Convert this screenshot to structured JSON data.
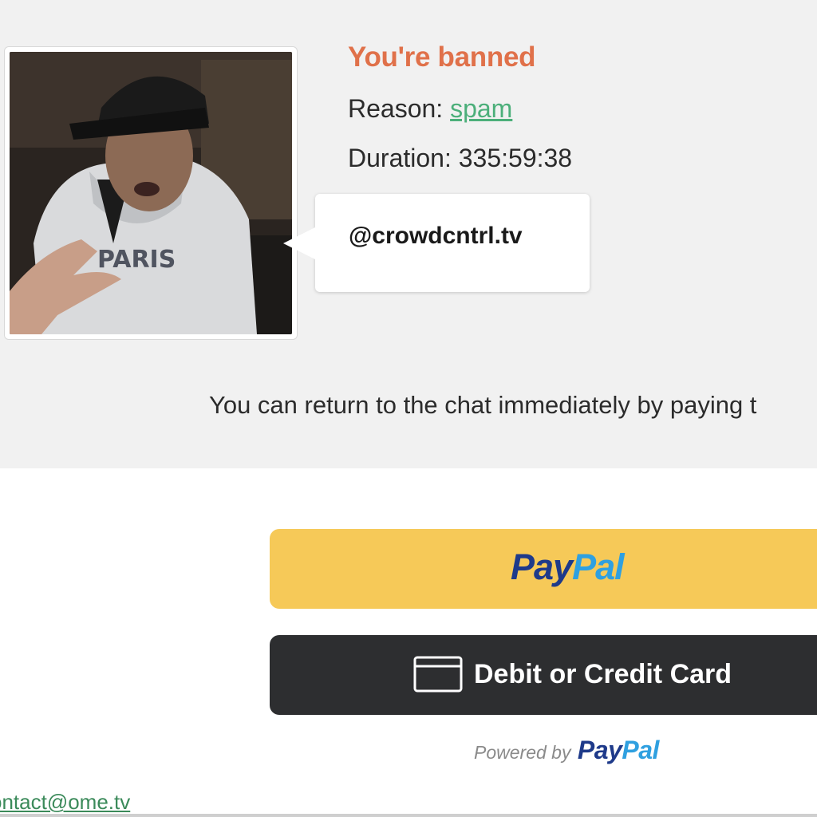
{
  "ban": {
    "title": "You're banned",
    "reason_label": "Reason:",
    "reason_value": "spam",
    "duration_label": "Duration:",
    "duration_value": "335:59:38",
    "return_text": "You can return to the chat immediately by paying t",
    "title_color": "#e0714a",
    "link_color": "#4caf7a"
  },
  "bubble": {
    "handle": "@crowdcntrl.tv"
  },
  "payment": {
    "paypal_button": {
      "logo_part1": "Pay",
      "logo_part2": "Pal",
      "bg_color": "#f6c958"
    },
    "card_button": {
      "label": "Debit or Credit Card",
      "icon": "credit-card-icon",
      "bg_color": "#2d2e30"
    },
    "powered_by": {
      "text": "Powered by",
      "logo_part1": "Pay",
      "logo_part2": "Pal"
    }
  },
  "footer": {
    "contact_email": "ontact@ome.tv"
  }
}
